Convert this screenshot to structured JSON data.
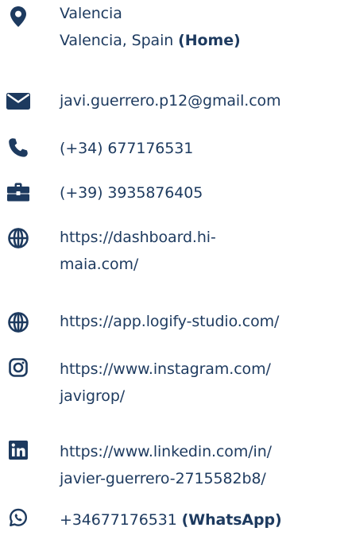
{
  "accent_color": "#1d3a5f",
  "location": {
    "icon": "map-marker-icon",
    "city": "Valencia",
    "address": "Valencia, Spain",
    "tag": "(Home)"
  },
  "email": {
    "icon": "envelope-icon",
    "value": "javi.guerrero.p12@gmail.com"
  },
  "phone": {
    "icon": "phone-icon",
    "value": "(+34) 677176531"
  },
  "work_phone": {
    "icon": "briefcase-icon",
    "value": "(+39) 3935876405"
  },
  "website_1": {
    "icon": "globe-icon",
    "line1": "https://dashboard.hi-",
    "line2": "maia.com/"
  },
  "website_2": {
    "icon": "globe-icon",
    "value": "https://app.logify-studio.com/"
  },
  "instagram": {
    "icon": "instagram-icon",
    "line1": "https://www.instagram.com/",
    "line2": "javigrop/"
  },
  "linkedin": {
    "icon": "linkedin-icon",
    "line1": "https://www.linkedin.com/in/",
    "line2": "javier-guerrero-2715582b8/"
  },
  "whatsapp": {
    "icon": "whatsapp-icon",
    "value": "+34677176531",
    "tag": "(WhatsApp)"
  }
}
